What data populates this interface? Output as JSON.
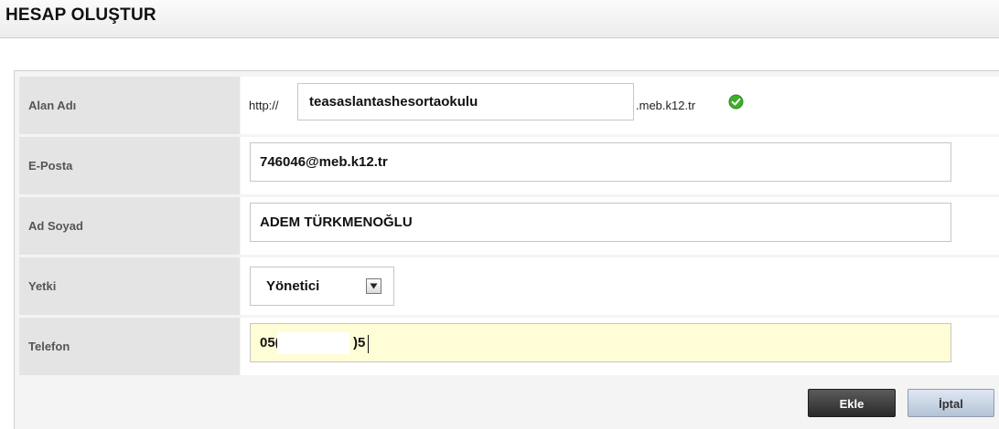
{
  "header": {
    "title": "HESAP OLUŞTUR"
  },
  "form": {
    "domain": {
      "label": "Alan Adı",
      "prefix": "http://",
      "value": "teasaslantashesortaokulu",
      "suffix": ".meb.k12.tr",
      "status_icon": "check-circle-icon",
      "status_color": "#3fae2a"
    },
    "email": {
      "label": "E-Posta",
      "value": "746046@meb.k12.tr"
    },
    "fullname": {
      "label": "Ad Soyad",
      "value": "ADEM TÜRKMENOĞLU"
    },
    "role": {
      "label": "Yetki",
      "selected": "Yönetici"
    },
    "phone": {
      "label": "Telefon",
      "value_visible_start": "05(",
      "value_visible_end": ")5"
    }
  },
  "actions": {
    "add_label": "Ekle",
    "cancel_label": "İptal"
  }
}
